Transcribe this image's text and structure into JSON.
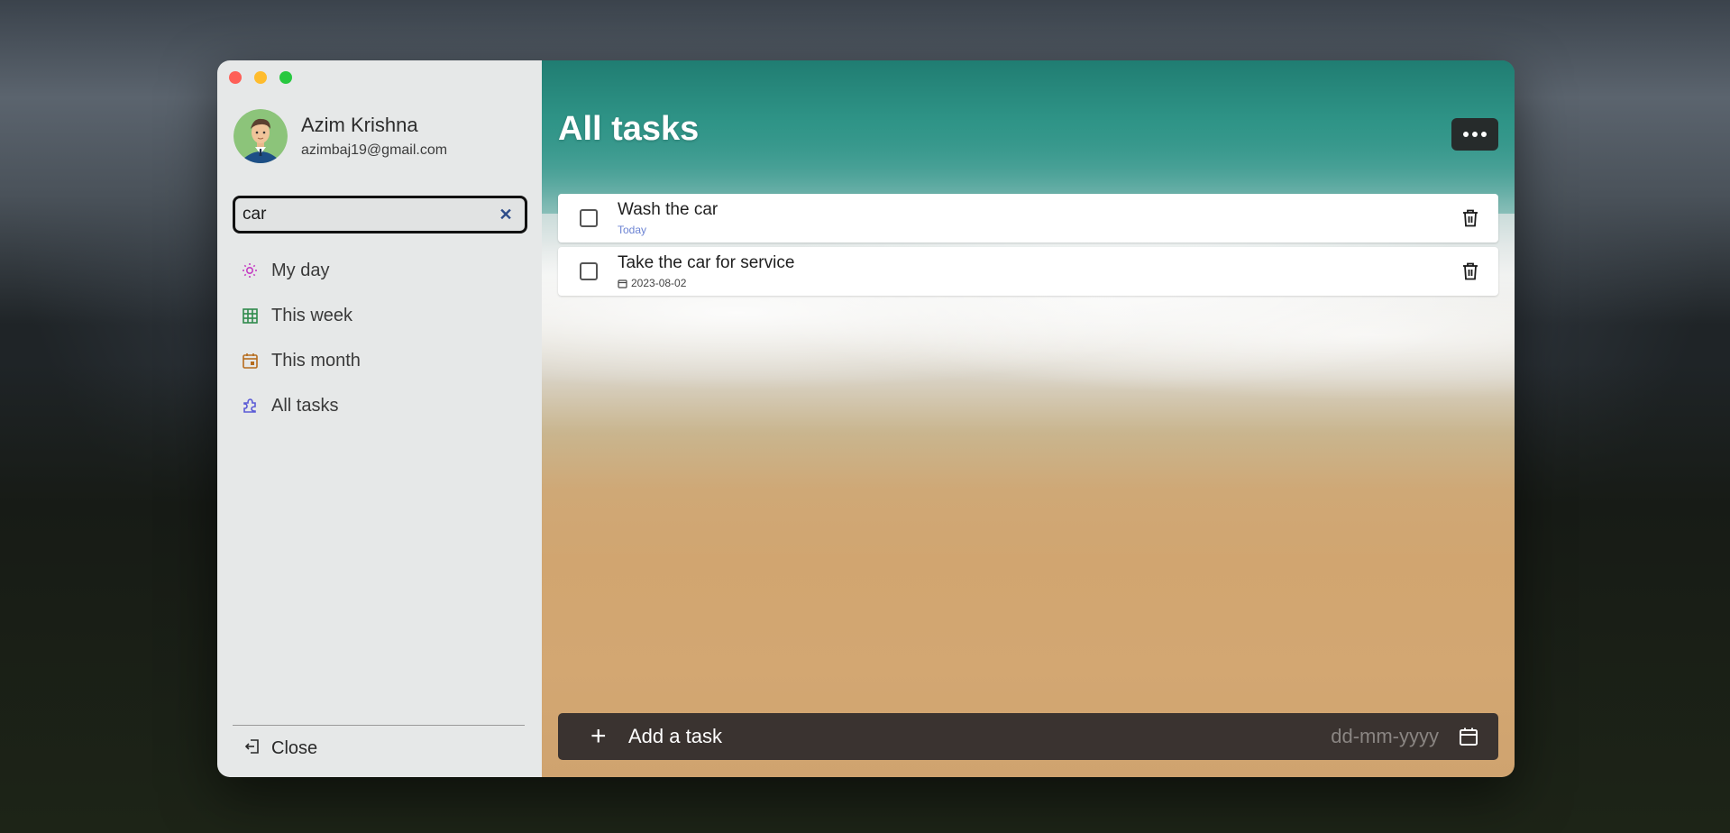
{
  "sidebar": {
    "user": {
      "name": "Azim Krishna",
      "email": "azimbaj19@gmail.com"
    },
    "search": {
      "value": "car",
      "clear_icon": "close-icon"
    },
    "nav": [
      {
        "label": "My day",
        "icon": "sun-icon",
        "color": "#c43dc3"
      },
      {
        "label": "This week",
        "icon": "grid-icon",
        "color": "#2f8a4c"
      },
      {
        "label": "This month",
        "icon": "calendar-icon",
        "color": "#b66c1d"
      },
      {
        "label": "All tasks",
        "icon": "puzzle-icon",
        "color": "#5a5ad6"
      }
    ],
    "close_label": "Close"
  },
  "main": {
    "title": "All tasks",
    "tasks": [
      {
        "title": "Wash the car",
        "meta": "Today"
      },
      {
        "title": "Take the car for service",
        "meta": "2023-08-02"
      }
    ],
    "add_task": {
      "placeholder": "Add a task",
      "date_placeholder": "dd-mm-yyyy"
    }
  }
}
